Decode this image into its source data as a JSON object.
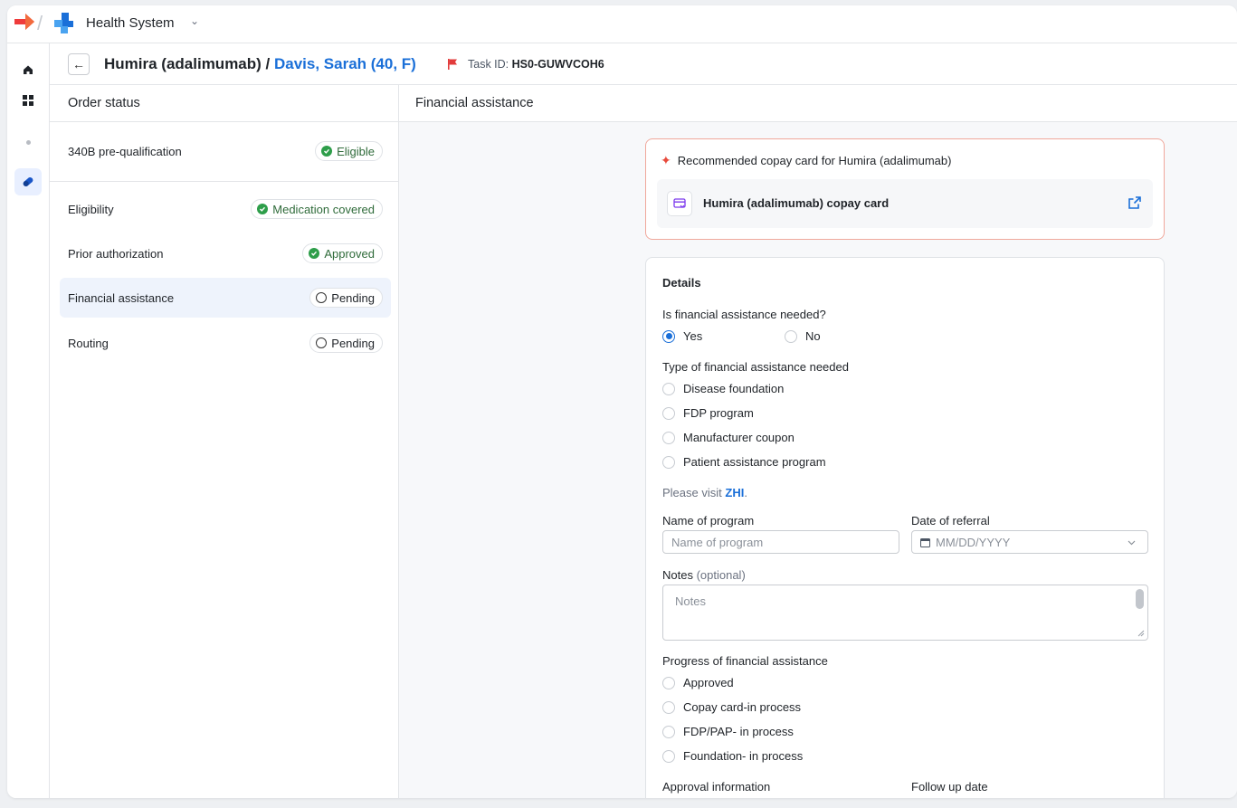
{
  "topbar": {
    "org_name": "Health System",
    "org_chevron": "⌄"
  },
  "rail": {
    "items": [
      "home-icon",
      "grid-icon",
      "dot-icon",
      "pill-icon"
    ]
  },
  "header": {
    "back_icon": "←",
    "drug": "Humira (adalimumab)",
    "sep": " / ",
    "patient": "Davis, Sarah (40, F)",
    "task_label": "Task ID: ",
    "task_id": "HS0-GUWVCOH6"
  },
  "order_status": {
    "title": "Order status",
    "rows": [
      {
        "label": "340B pre-qualification",
        "status": "Eligible",
        "state": "ok"
      },
      {
        "label": "Eligibility",
        "status": "Medication covered",
        "state": "ok"
      },
      {
        "label": "Prior authorization",
        "status": "Approved",
        "state": "ok"
      },
      {
        "label": "Financial assistance",
        "status": "Pending",
        "state": "pending"
      },
      {
        "label": "Routing",
        "status": "Pending",
        "state": "pending"
      }
    ]
  },
  "financial": {
    "title": "Financial assistance",
    "recommended_title": "Recommended copay card for Humira (adalimumab)",
    "card_name": "Humira (adalimumab) copay card",
    "details": {
      "heading": "Details",
      "q_needed": "Is financial assistance needed?",
      "yes": "Yes",
      "no": "No",
      "type_label": "Type of financial assistance needed",
      "types": [
        "Disease foundation",
        "FDP program",
        "Manufacturer coupon",
        "Patient assistance program"
      ],
      "visit_prefix": "Please visit ",
      "visit_link": "ZHI",
      "visit_suffix": ".",
      "program_label": "Name of program",
      "program_placeholder": "Name of program",
      "referral_label": "Date of referral",
      "referral_placeholder": "MM/DD/YYYY",
      "notes_label": "Notes",
      "notes_optional": " (optional)",
      "notes_placeholder": "Notes",
      "progress_label": "Progress of financial assistance",
      "progress": [
        "Approved",
        "Copay card-in process",
        "FDP/PAP- in process",
        "Foundation- in process"
      ],
      "approval_label": "Approval information",
      "followup_label": "Follow up date"
    }
  }
}
